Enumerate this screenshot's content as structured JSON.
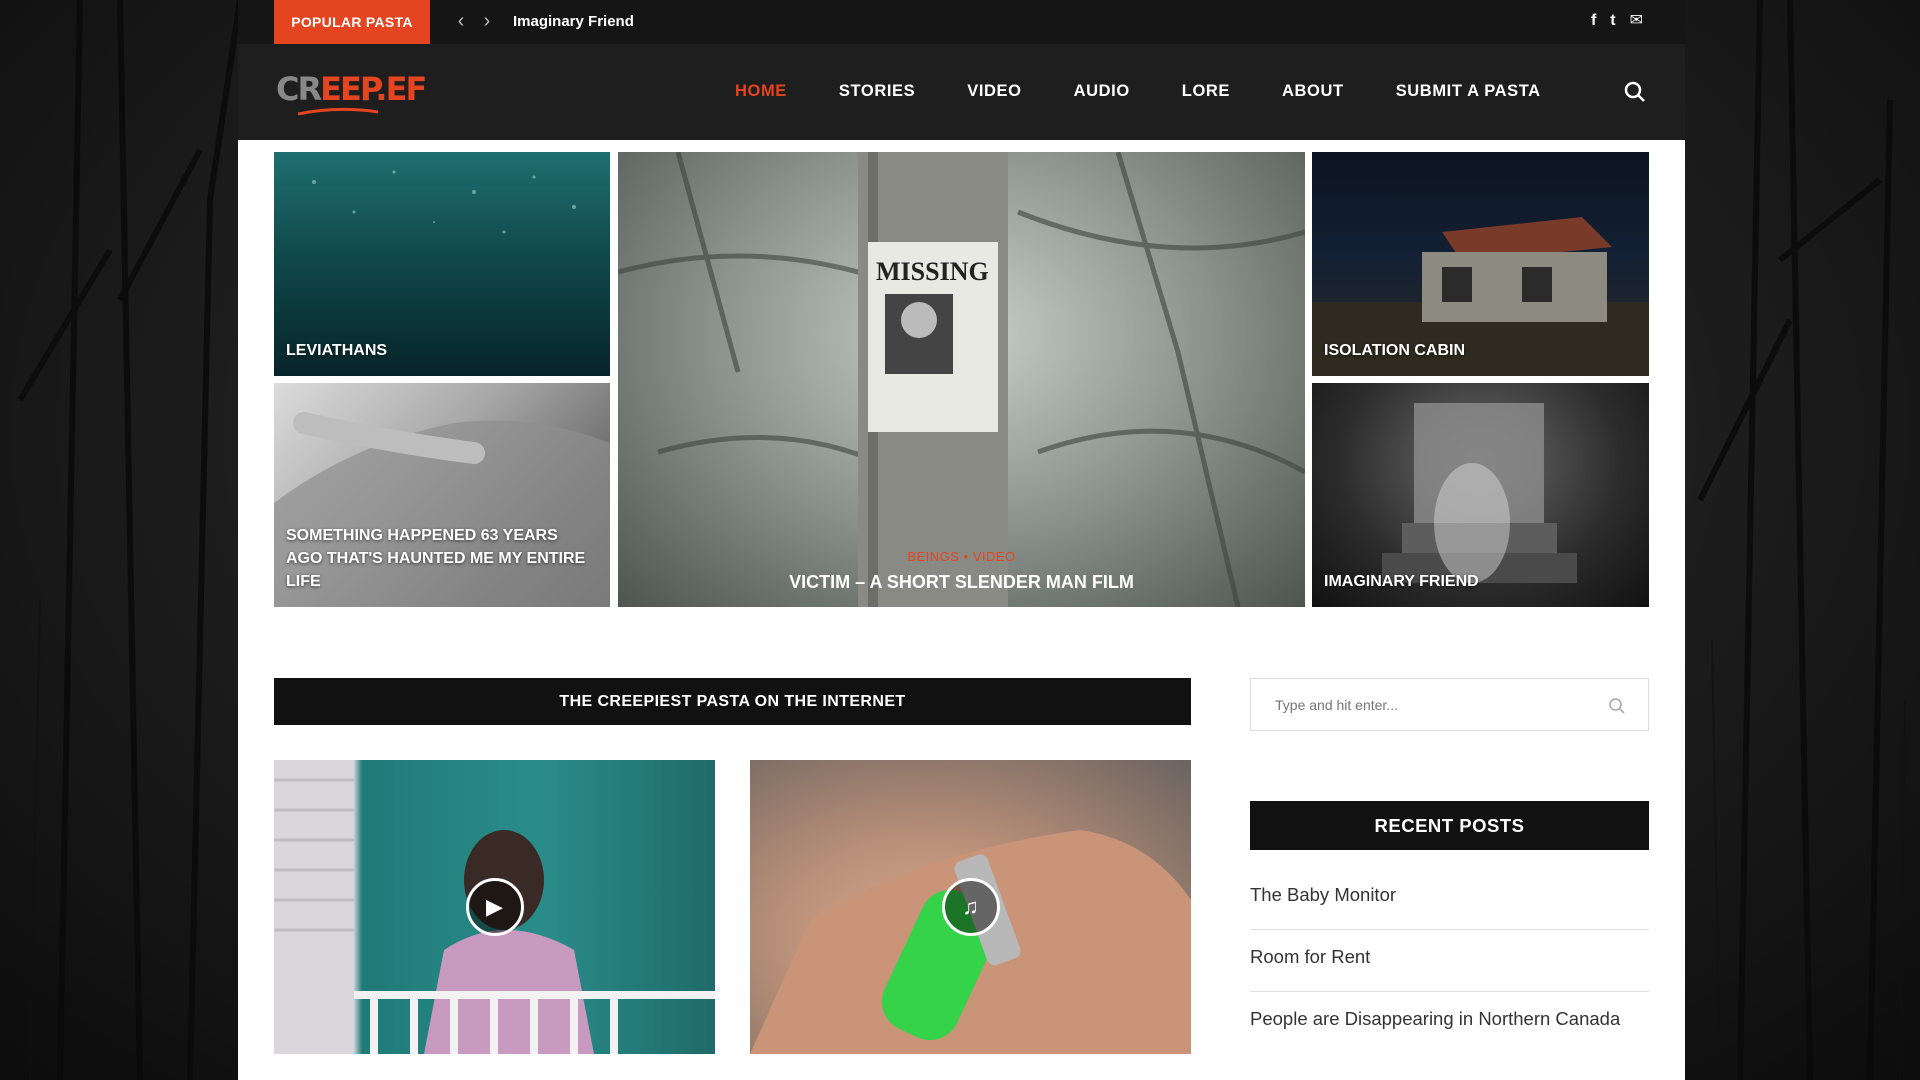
{
  "topbar": {
    "badge": "POPULAR PASTA",
    "prev_icon": "chevron-left-icon",
    "next_icon": "chevron-right-icon",
    "ticker_title": "Imaginary Friend",
    "social": [
      {
        "icon": "facebook-icon",
        "glyph": "f"
      },
      {
        "icon": "twitter-icon",
        "glyph": "t"
      },
      {
        "icon": "mail-icon",
        "glyph": "✉"
      }
    ]
  },
  "nav": {
    "logo_text_a": "CR",
    "logo_text_b": "EEP",
    "logo_text_c": ".EF",
    "items": [
      "HOME",
      "STORIES",
      "VIDEO",
      "AUDIO",
      "LORE",
      "ABOUT",
      "SUBMIT A PASTA"
    ],
    "active": "HOME",
    "accent": "#e4441f"
  },
  "hero": {
    "tiles": [
      {
        "title": "LEVIATHANS"
      },
      {
        "title": "SOMETHING HAPPENED 63 YEARS AGO THAT'S HAUNTED ME MY ENTIRE LIFE"
      },
      {
        "title": "VICTIM – A SHORT SLENDER MAN FILM",
        "categories": "BEINGS  •  VIDEO",
        "poster_text": "MISSING"
      },
      {
        "title": "ISOLATION CABIN"
      },
      {
        "title": "IMAGINARY FRIEND"
      }
    ]
  },
  "main": {
    "section_title": "THE CREEPIEST PASTA ON THE INTERNET",
    "posts": [
      {
        "media_icon": "play-icon",
        "glyph": "▶"
      },
      {
        "media_icon": "music-note-icon",
        "glyph": "♫"
      }
    ]
  },
  "sidebar": {
    "search_placeholder": "Type and hit enter...",
    "recent_title": "RECENT POSTS",
    "recent_posts": [
      "The Baby Monitor",
      "Room for Rent",
      "People are Disappearing in Northern Canada"
    ]
  }
}
